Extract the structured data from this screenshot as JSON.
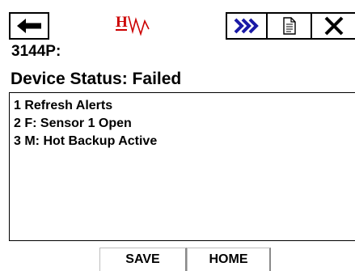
{
  "toolbar": {
    "back_icon": "left-arrow-icon",
    "next_icon": "double-chevron-right-icon",
    "doc_icon": "document-icon",
    "close_icon": "close-x-icon",
    "next_color": "#1a1aa6"
  },
  "logo": {
    "text": "H",
    "color": "#cc0000"
  },
  "device": {
    "tag": "3144P:",
    "status": "Device Status: Failed"
  },
  "alerts": {
    "items": [
      "1 Refresh Alerts",
      "2 F: Sensor 1 Open",
      "3 M: Hot Backup Active"
    ]
  },
  "bottom": {
    "save_label": "SAVE",
    "home_label": "HOME"
  }
}
